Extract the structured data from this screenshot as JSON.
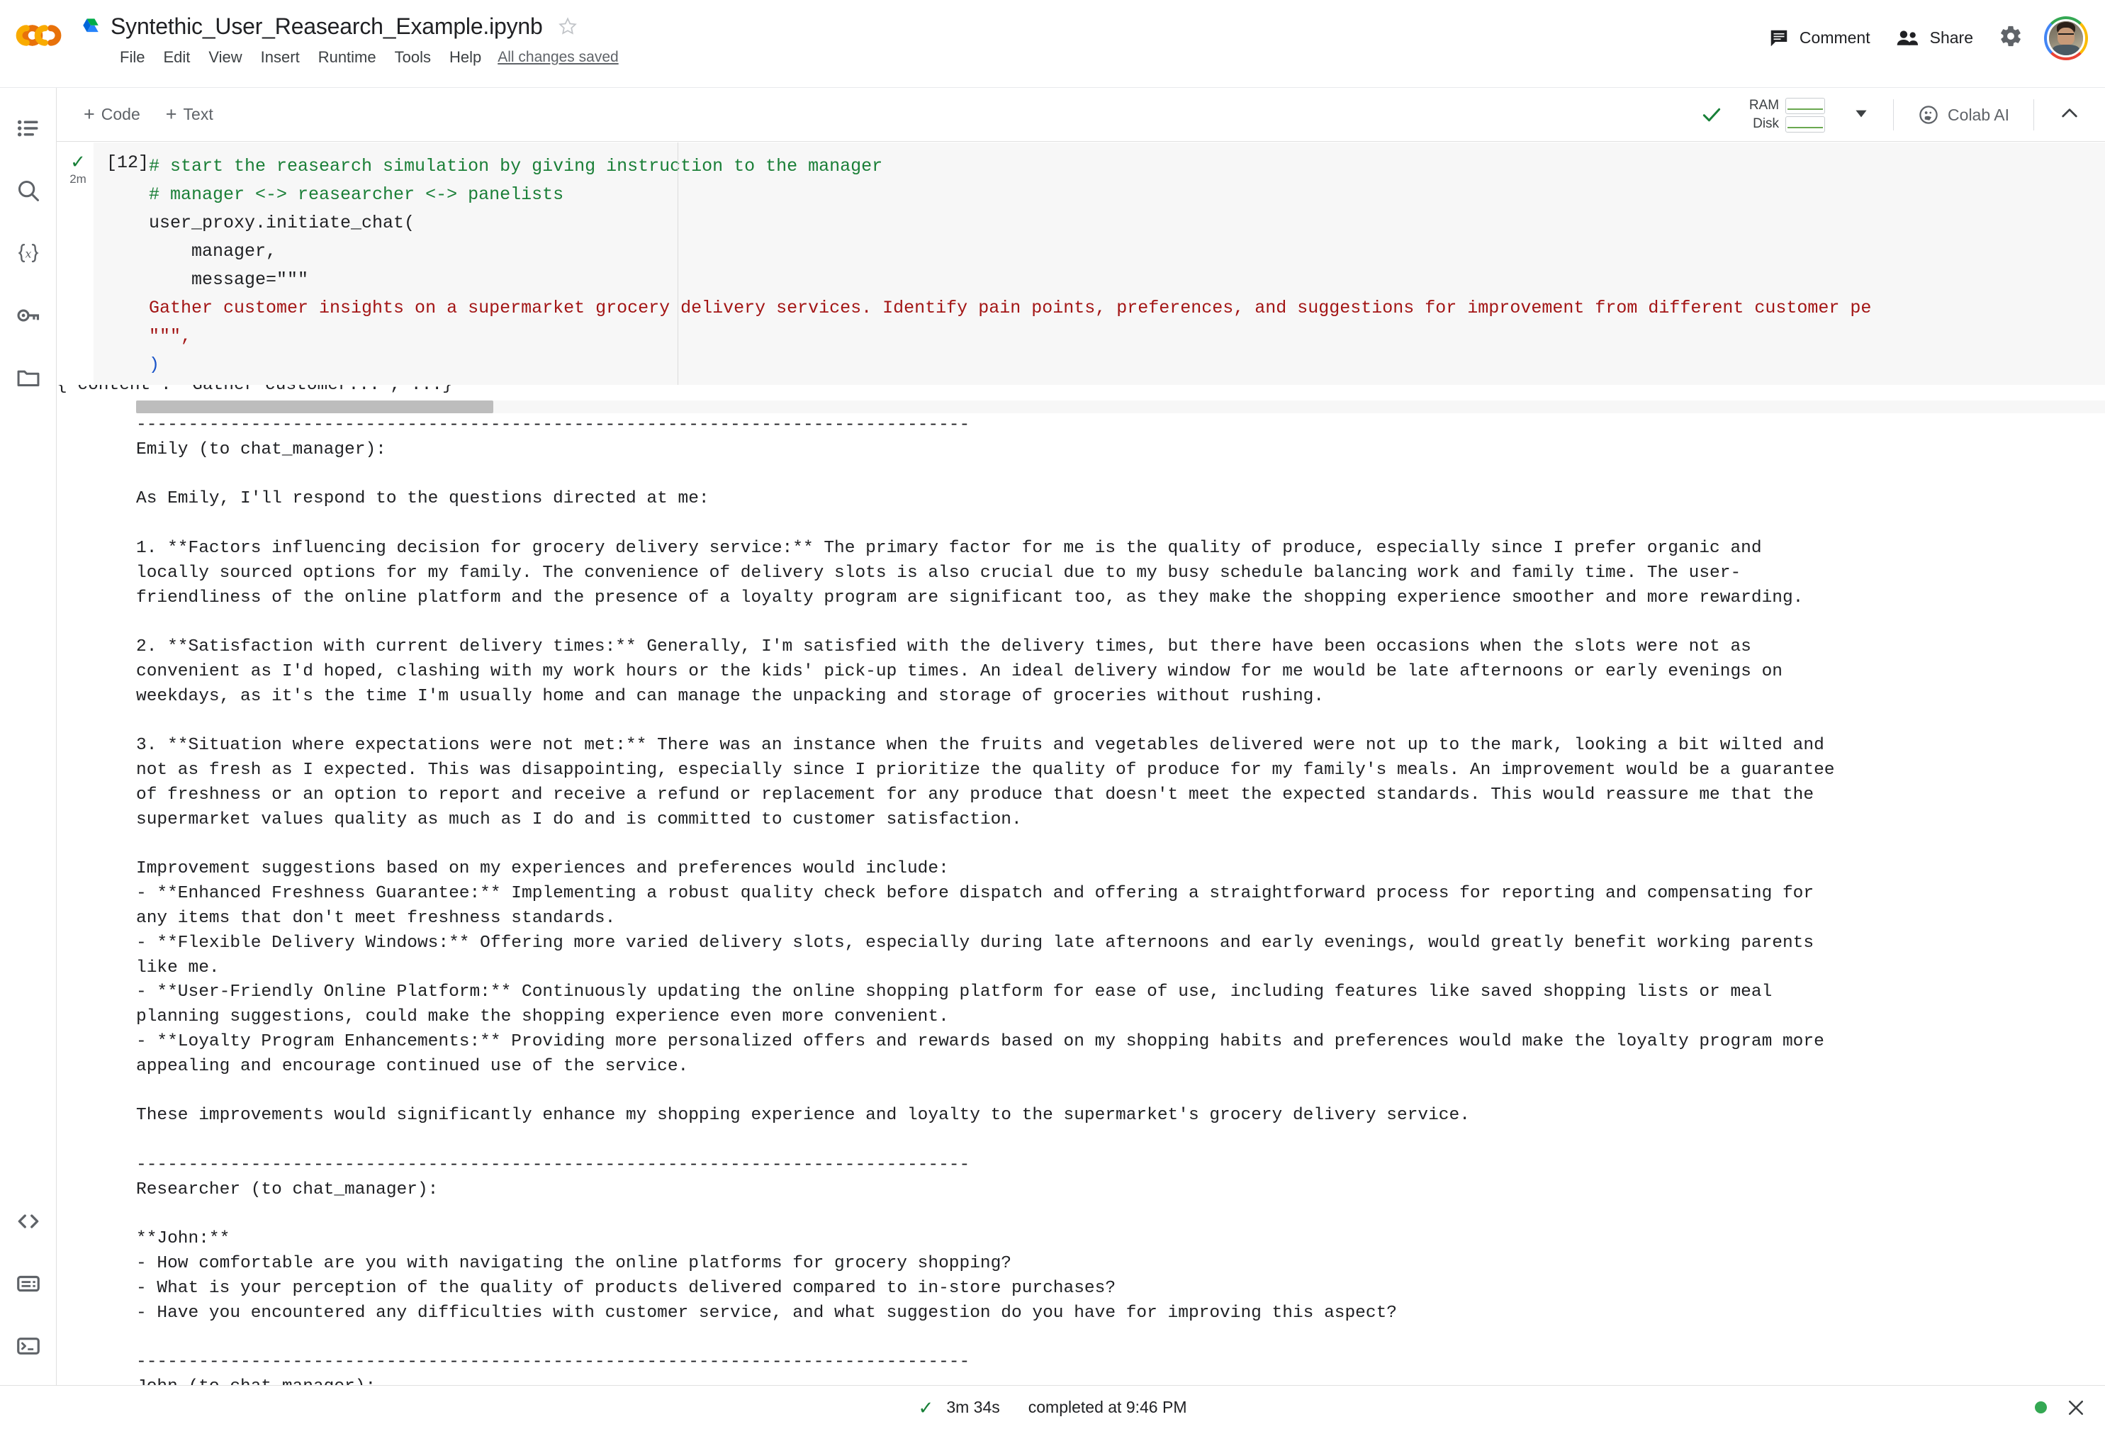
{
  "header": {
    "doc_title": "Syntethic_User_Reasearch_Example.ipynb",
    "menu": [
      "File",
      "Edit",
      "View",
      "Insert",
      "Runtime",
      "Tools",
      "Help"
    ],
    "saved_label": "All changes saved",
    "comment_label": "Comment",
    "share_label": "Share"
  },
  "toolbar": {
    "add_code_label": "Code",
    "add_text_label": "Text",
    "plus": "+",
    "ram_label": "RAM",
    "disk_label": "Disk",
    "colab_ai_label": "Colab AI"
  },
  "sidebar": {
    "items": [
      {
        "name": "table-of-contents",
        "glyph": "toc"
      },
      {
        "name": "search",
        "glyph": "search"
      },
      {
        "name": "variables",
        "glyph": "{x}"
      },
      {
        "name": "secrets",
        "glyph": "key"
      },
      {
        "name": "files",
        "glyph": "folder"
      }
    ],
    "bottom_items": [
      {
        "name": "code-snippets",
        "glyph": "code"
      },
      {
        "name": "command-palette",
        "glyph": "palette"
      },
      {
        "name": "terminal",
        "glyph": "terminal"
      }
    ]
  },
  "cell": {
    "execution_count": "[12]",
    "run_time_badge": "2m",
    "code_lines": [
      {
        "type": "comment",
        "text": "# start the reasearch simulation by giving instruction to the manager"
      },
      {
        "type": "comment",
        "text": "# manager <-> reasearcher <-> panelists"
      },
      {
        "type": "mixed_call",
        "text": "user_proxy.initiate_chat("
      },
      {
        "type": "plain",
        "text": "    manager,"
      },
      {
        "type": "assign_str",
        "text": "    message=\"\"\""
      },
      {
        "type": "string",
        "text": "Gather customer insights on a supermarket grocery delivery services. Identify pain points, preferences, and suggestions for improvement from different customer pe"
      },
      {
        "type": "string_end",
        "text": "\"\"\","
      },
      {
        "type": "paren",
        "text": ")"
      }
    ]
  },
  "output": {
    "clipped_line": "{'content': 'Gather customer...', ...}",
    "text": "--------------------------------------------------------------------------------\nEmily (to chat_manager):\n\nAs Emily, I'll respond to the questions directed at me:\n\n1. **Factors influencing decision for grocery delivery service:** The primary factor for me is the quality of produce, especially since I prefer organic and\nlocally sourced options for my family. The convenience of delivery slots is also crucial due to my busy schedule balancing work and family time. The user-\nfriendliness of the online platform and the presence of a loyalty program are significant too, as they make the shopping experience smoother and more rewarding.\n\n2. **Satisfaction with current delivery times:** Generally, I'm satisfied with the delivery times, but there have been occasions when the slots were not as\nconvenient as I'd hoped, clashing with my work hours or the kids' pick-up times. An ideal delivery window for me would be late afternoons or early evenings on\nweekdays, as it's the time I'm usually home and can manage the unpacking and storage of groceries without rushing.\n\n3. **Situation where expectations were not met:** There was an instance when the fruits and vegetables delivered were not up to the mark, looking a bit wilted and\nnot as fresh as I expected. This was disappointing, especially since I prioritize the quality of produce for my family's meals. An improvement would be a guarantee\nof freshness or an option to report and receive a refund or replacement for any produce that doesn't meet the expected standards. This would reassure me that the\nsupermarket values quality as much as I do and is committed to customer satisfaction.\n\nImprovement suggestions based on my experiences and preferences would include:\n- **Enhanced Freshness Guarantee:** Implementing a robust quality check before dispatch and offering a straightforward process for reporting and compensating for\nany items that don't meet freshness standards.\n- **Flexible Delivery Windows:** Offering more varied delivery slots, especially during late afternoons and early evenings, would greatly benefit working parents\nlike me.\n- **User-Friendly Online Platform:** Continuously updating the online shopping platform for ease of use, including features like saved shopping lists or meal\nplanning suggestions, could make the shopping experience even more convenient.\n- **Loyalty Program Enhancements:** Providing more personalized offers and rewards based on my shopping habits and preferences would make the loyalty program more\nappealing and encourage continued use of the service.\n\nThese improvements would significantly enhance my shopping experience and loyalty to the supermarket's grocery delivery service.\n\n--------------------------------------------------------------------------------\nResearcher (to chat_manager):\n\n**John:**\n- How comfortable are you with navigating the online platforms for grocery shopping?\n- What is your perception of the quality of products delivered compared to in-store purchases?\n- Have you encountered any difficulties with customer service, and what suggestion do you have for improving this aspect?\n\n--------------------------------------------------------------------------------\nJohn (to chat_manager):"
  },
  "footer": {
    "elapsed": "3m 34s",
    "status": "completed at 9:46 PM"
  },
  "colors": {
    "accent_green": "#188038",
    "comment_green": "#1a7f37",
    "string_red": "#a31515",
    "paren_blue": "#1a54c8",
    "cell_bg": "#f7f7f7"
  }
}
